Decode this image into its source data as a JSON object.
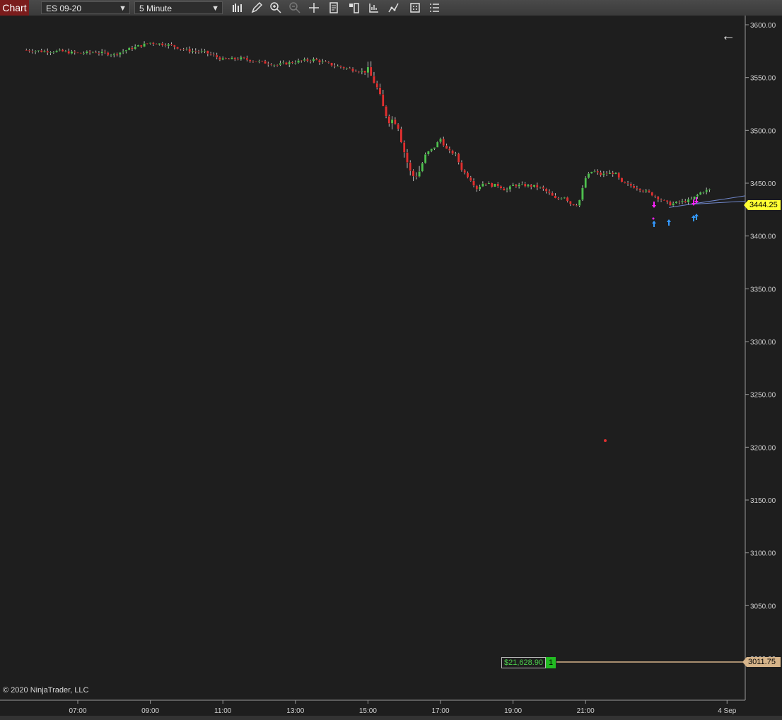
{
  "toolbar": {
    "tab_label": "Chart",
    "instrument": "ES 09-20",
    "interval": "5 Minute",
    "icons": [
      "bar-type-icon",
      "draw-pencil-icon",
      "zoom-in-icon",
      "zoom-out-icon",
      "crosshair-icon",
      "data-box-icon",
      "chart-trader-icon",
      "indicators-icon",
      "strategies-icon",
      "templates-icon",
      "properties-icon"
    ]
  },
  "chart": {
    "copyright": "© 2020 NinjaTrader, LLC",
    "last_price": "3444.25",
    "position_price": "3011.75",
    "pnl": "$21,628.90",
    "position_qty": "1",
    "colors": {
      "up": "#4fc04f",
      "down": "#e03030",
      "background": "#1e1e1e",
      "buy_marker": "#3399ff",
      "sell_marker": "#ff22ff",
      "position_line": "#d6b48a",
      "last_flag": "#ffff33"
    }
  },
  "chart_data": {
    "type": "candlestick",
    "y_ticks": [
      "3600.00",
      "3550.00",
      "3500.00",
      "3450.00",
      "3400.00",
      "3350.00",
      "3300.00",
      "3250.00",
      "3200.00",
      "3150.00",
      "3100.00",
      "3050.00",
      "3000.00"
    ],
    "x_ticks": [
      "07:00",
      "09:00",
      "11:00",
      "13:00",
      "15:00",
      "17:00",
      "19:00",
      "21:00",
      "4 Sep"
    ],
    "ylim": [
      2985,
      3620
    ],
    "close_path": [
      [
        5.5,
        3576
      ],
      [
        6.0,
        3575
      ],
      [
        6.5,
        3575
      ],
      [
        7.0,
        3573
      ],
      [
        7.5,
        3574
      ],
      [
        8.0,
        3572
      ],
      [
        8.5,
        3578
      ],
      [
        9.0,
        3583
      ],
      [
        9.5,
        3581
      ],
      [
        10.0,
        3576
      ],
      [
        10.5,
        3574
      ],
      [
        11.0,
        3567
      ],
      [
        11.5,
        3568
      ],
      [
        12.0,
        3565
      ],
      [
        12.5,
        3562
      ],
      [
        13.0,
        3565
      ],
      [
        13.5,
        3567
      ],
      [
        14.0,
        3562
      ],
      [
        14.5,
        3558
      ],
      [
        15.0,
        3555
      ],
      [
        15.2,
        3545
      ],
      [
        15.4,
        3522
      ],
      [
        15.6,
        3510
      ],
      [
        15.8,
        3510
      ],
      [
        16.0,
        3480
      ],
      [
        16.2,
        3456
      ],
      [
        16.4,
        3460
      ],
      [
        16.6,
        3478
      ],
      [
        16.8,
        3483
      ],
      [
        17.0,
        3492
      ],
      [
        17.2,
        3480
      ],
      [
        17.4,
        3478
      ],
      [
        17.6,
        3462
      ],
      [
        17.8,
        3455
      ],
      [
        18.0,
        3445
      ],
      [
        18.2,
        3451
      ],
      [
        18.4,
        3448
      ],
      [
        18.6,
        3448
      ],
      [
        18.8,
        3443
      ],
      [
        19.0,
        3448
      ],
      [
        19.3,
        3448
      ],
      [
        19.6,
        3447
      ],
      [
        19.8,
        3445
      ],
      [
        20.0,
        3440
      ],
      [
        20.2,
        3434
      ],
      [
        20.4,
        3438
      ],
      [
        20.6,
        3430
      ],
      [
        20.8,
        3430
      ],
      [
        21.0,
        3455
      ],
      [
        21.2,
        3462
      ],
      [
        21.4,
        3458
      ],
      [
        21.8,
        3460
      ],
      [
        22.0,
        3450
      ],
      [
        22.4,
        3446
      ],
      [
        22.8,
        3440
      ],
      [
        23.0,
        3436
      ],
      [
        23.3,
        3430
      ],
      [
        23.6,
        3432
      ],
      [
        23.9,
        3434
      ],
      [
        24.2,
        3442
      ],
      [
        24.45,
        3444.25
      ]
    ]
  }
}
